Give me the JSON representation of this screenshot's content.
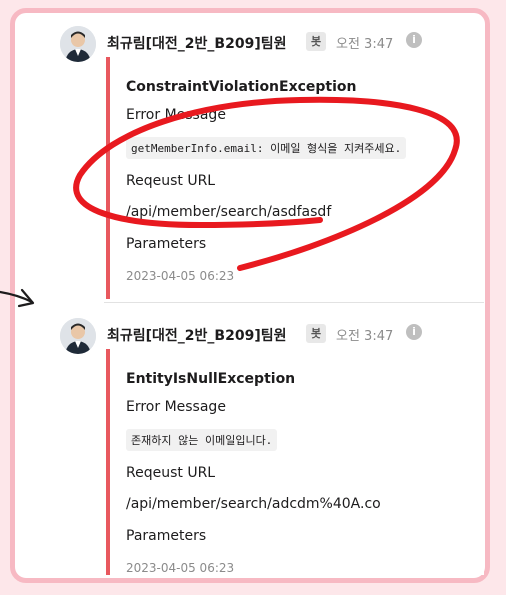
{
  "messages": [
    {
      "sender": "최규림[대전_2반_B209]팀원",
      "badge": "봇",
      "time": "오전 3:47",
      "exception": "ConstraintViolationException",
      "error_label": "Error Message",
      "error_text": "getMemberInfo.email: 이메일 형식을 지켜주세요.",
      "url_label": "Reqeust URL",
      "url": "/api/member/search/asdfasdf",
      "params_label": "Parameters",
      "timestamp": "2023-04-05 06:23"
    },
    {
      "sender": "최규림[대전_2반_B209]팀원",
      "badge": "봇",
      "time": "오전 3:47",
      "exception": "EntityIsNullException",
      "error_label": "Error Message",
      "error_text": "존재하지 않는 이메일입니다.",
      "url_label": "Reqeust URL",
      "url": "/api/member/search/adcdm%40A.co",
      "params_label": "Parameters",
      "timestamp": "2023-04-05 06:23"
    }
  ],
  "colors": {
    "accent_bar": "#e8585e",
    "frame_border": "#f7b9c3",
    "annotation_red": "#e8191f"
  },
  "icons": [
    "avatar",
    "info-icon",
    "arrow-icon",
    "circle-annotation"
  ]
}
